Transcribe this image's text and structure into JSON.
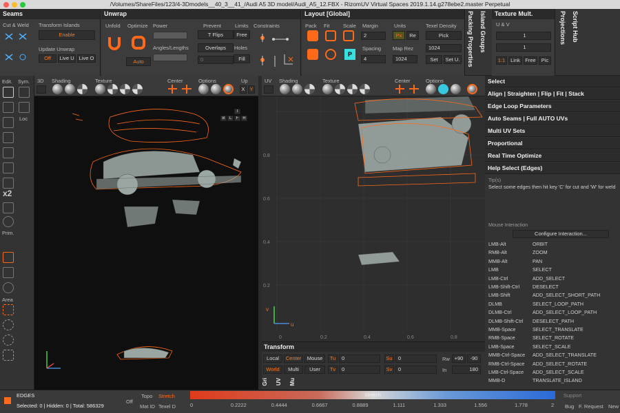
{
  "window": {
    "title": "/Volumes/ShareFiles/123/4-3Dmodels__40_3__41_/Audi A5 3D model/Audi_A5_12.FBX - RizomUV  Virtual Spaces 2019.1.14.g278ebe2.master Perpetual"
  },
  "seams": {
    "title": "Seams",
    "cut_weld": "Cut & Weld",
    "transform_islands": "Transform Islands",
    "enable": "Enable",
    "update_unwrap": "Update Unwrap",
    "off": "Off",
    "live_u": "Live U",
    "live_o": "Live O"
  },
  "unwrap": {
    "title": "Unwrap",
    "unfold": "Unfold",
    "optimize": "Optimize",
    "power": "Power",
    "angles_lengths": "Angles/Lengths",
    "auto": "Auto",
    "prevent": "Prevent",
    "t_flips": "T Flips",
    "overlaps": "Overlaps",
    "overlap_val": "0",
    "limits": "Limits",
    "free": "Free",
    "holes": "Holes",
    "fill": "Fill",
    "constraints": "Constraints"
  },
  "layout": {
    "title": "Layout [Global]",
    "pack": "Pack",
    "fit": "Fit",
    "scale": "Scale",
    "margin": "Margin",
    "margin_val": "2",
    "spacing": "Spacing",
    "spacing_val": "4",
    "units": "Units",
    "px": "Px",
    "re": "Re",
    "map_rez": "Map Rez",
    "map_rez_val": "1024",
    "texel_density": "Texel Density",
    "pick": "Pick",
    "td_val": "1024",
    "set": "Set",
    "set_u": "Set U."
  },
  "vertical_tabs": {
    "packing": "Packing Properties",
    "island": "Island Groups",
    "projections": "Projections",
    "script": "Script Hub"
  },
  "texture_mult": {
    "title": "Texture Mult.",
    "uv": "U & V",
    "v1": "1",
    "v2": "1",
    "ratio": "1:1",
    "link": "Link",
    "free": "Free",
    "pic": "Pic"
  },
  "left_tools": {
    "edit": "Edit.",
    "sym": "Sym.",
    "loc": "Loc",
    "x2": "x2",
    "prim": "Prim.",
    "area": "Area"
  },
  "view3d": {
    "label": "3D",
    "shading": "Shading",
    "texture": "Texture",
    "center": "Center",
    "options": "Options",
    "up": "Up",
    "up_val": "Y",
    "cube": [
      "T",
      "B",
      "L",
      "F",
      "R"
    ]
  },
  "viewuv": {
    "label": "UV",
    "shading": "Shading",
    "texture": "Texture",
    "center": "Center",
    "options": "Options",
    "ticks_x": [
      "0",
      "0.2",
      "0.4",
      "0.6",
      "0.8"
    ],
    "ticks_y": [
      "0.2",
      "0.4",
      "0.6",
      "0.8"
    ],
    "axis_u": "u",
    "axis_v": "v"
  },
  "transform": {
    "title": "Transform",
    "local": "Local",
    "center": "Center",
    "mouse": "Mouse",
    "world": "World",
    "multi": "Multi",
    "user": "User",
    "tu": "Tu",
    "tv": "Tv",
    "su": "Su",
    "sv": "Sv",
    "tu_val": "0",
    "tv_val": "0",
    "su_val": "0",
    "sv_val": "0",
    "rw": "Rw",
    "rw_plus": "+90",
    "rw_minus": "-90",
    "in": "In",
    "in_val": "180",
    "tabs": [
      "Gri",
      "UV",
      "Mu"
    ]
  },
  "right_panel": {
    "sections": [
      "Select",
      "Align | Straighten | Flip | Fit | Stack",
      "Edge Loop Parameters",
      "Auto Seams | Full AUTO UVs",
      "Multi UV Sets",
      "Proportional",
      "Real Time Optimize",
      "Help Select (Edges)"
    ],
    "tips_label": "Tip(s)",
    "tip_text": "Select some edges then hit key 'C' for cut and 'W' for weld",
    "mouse_interaction": "Mouse Interaction",
    "configure": "Configure Interaction...",
    "bindings": [
      [
        "LMB-Alt",
        "ORBIT"
      ],
      [
        "RMB-Alt",
        "ZOOM"
      ],
      [
        "MMB-Alt",
        "PAN"
      ],
      [
        "LMB",
        "SELECT"
      ],
      [
        "LMB-Ctrl",
        "ADD_SELECT"
      ],
      [
        "LMB-Shift-Ctrl",
        "DESELECT"
      ],
      [
        "LMB-Shift",
        "ADD_SELECT_SHORT_PATH"
      ],
      [
        "DLMB",
        "SELECT_LOOP_PATH"
      ],
      [
        "DLMB-Ctrl",
        "ADD_SELECT_LOOP_PATH"
      ],
      [
        "DLMB-Shift-Ctrl",
        "DESELECT_PATH"
      ],
      [
        "MMB-Space",
        "SELECT_TRANSLATE"
      ],
      [
        "RMB-Space",
        "SELECT_ROTATE"
      ],
      [
        "LMB-Space",
        "SELECT_SCALE"
      ],
      [
        "MMB-Ctrl-Space",
        "ADD_SELECT_TRANSLATE"
      ],
      [
        "RMB-Ctrl-Space",
        "ADD_SELECT_ROTATE"
      ],
      [
        "LMB-Ctrl-Space",
        "ADD_SELECT_SCALE"
      ],
      [
        "MMB-D",
        "TRANSLATE_ISLAND"
      ]
    ]
  },
  "status": {
    "mode": "EDGES",
    "counts": "Selected: 0 | Hidden: 0 | Total: 586329",
    "off": "Off",
    "topo": "Topo",
    "stretch": "Stretch",
    "mat_id": "Mat ID",
    "texel_d": "Texel D",
    "bar_label": "Stretch",
    "scale": [
      "0",
      "0.2222",
      "0.4444",
      "0.6667",
      "0.8889",
      "1.111",
      "1.333",
      "1.556",
      "1.778",
      "2"
    ],
    "support": "Support",
    "bug": "Bug",
    "f_request": "F. Request",
    "new": "New"
  },
  "colors": {
    "accent": "#ff6a1a",
    "mesh": "#9aa6a2"
  }
}
